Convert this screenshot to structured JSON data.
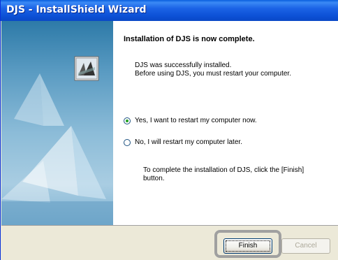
{
  "window": {
    "title": "DJS - InstallShield Wizard"
  },
  "content": {
    "heading": "Installation of DJS is now complete.",
    "message_line1": "DJS was successfully installed.",
    "message_line2": "Before using DJS, you must restart your computer.",
    "options": [
      {
        "label": "Yes, I want to restart my computer now.",
        "checked": true
      },
      {
        "label": "No, I will restart my computer later.",
        "checked": false
      }
    ],
    "note_line1": "To complete the installation of DJS, click the [Finish]",
    "note_line2": "button."
  },
  "buttons": {
    "finish_label": "Finish",
    "cancel_label": "Cancel",
    "cancel_enabled": false
  },
  "colors": {
    "titlebar": "#0a49c6",
    "panel_blue": "#5a9bc2",
    "dialog_face": "#ece9d8"
  },
  "icons": {
    "panel_logo": "installshield-logo-icon"
  }
}
